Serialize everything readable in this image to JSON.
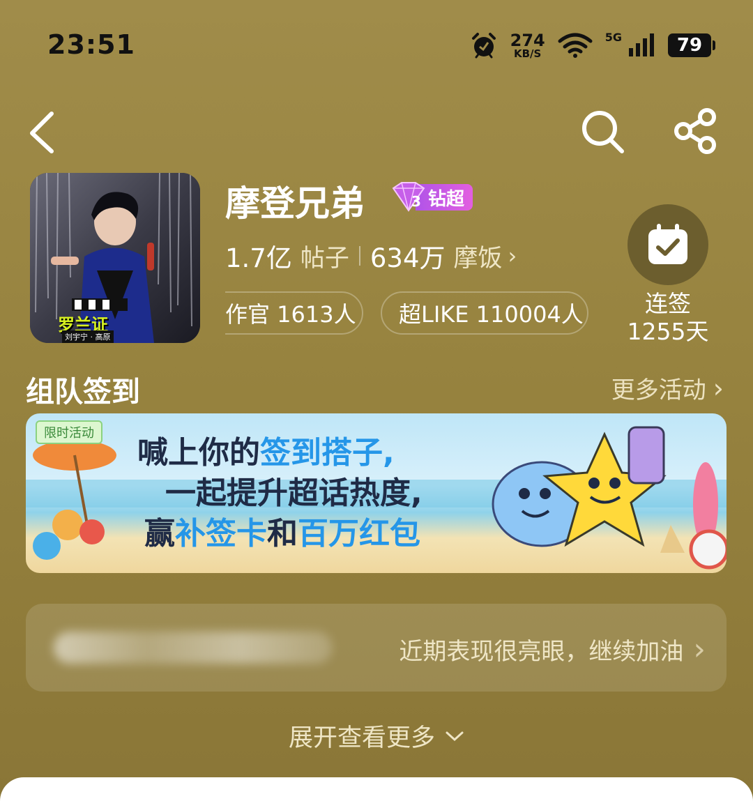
{
  "status_bar": {
    "time": "23:51",
    "net_speed": "274",
    "net_unit": "KB/S",
    "signal": "5G",
    "battery": "79"
  },
  "header": {
    "title": "摩登兄弟",
    "badge_label": "钻超",
    "cover_caption": "刘宇宁 · 高原",
    "cover_logo": "罗兰证",
    "posts_count": "1.7亿",
    "posts_label": "帖子",
    "fans_count": "634万",
    "fans_label": "摩饭",
    "pill_1": "作官 1613人",
    "pill_2": "超LIKE 110004人",
    "checkin_line1": "连签",
    "checkin_line2": "1255天"
  },
  "section": {
    "title": "组队签到",
    "more": "更多活动"
  },
  "banner": {
    "tag": "限时活动",
    "line1_a": "喊上你的",
    "line1_b": "签到搭子,",
    "line2": "一起提升超话热度,",
    "line3_a": "赢",
    "line3_b": "补签卡",
    "line3_c": "和",
    "line3_d": "百万红包"
  },
  "status_card": {
    "message": "近期表现很亮眼，继续加油"
  },
  "expand": {
    "label": "展开查看更多"
  },
  "colors": {
    "background": "#9a8642",
    "badge_gradient_start": "#b054e8",
    "badge_gradient_end": "#e35ee0",
    "banner_highlight": "#2596e8"
  }
}
